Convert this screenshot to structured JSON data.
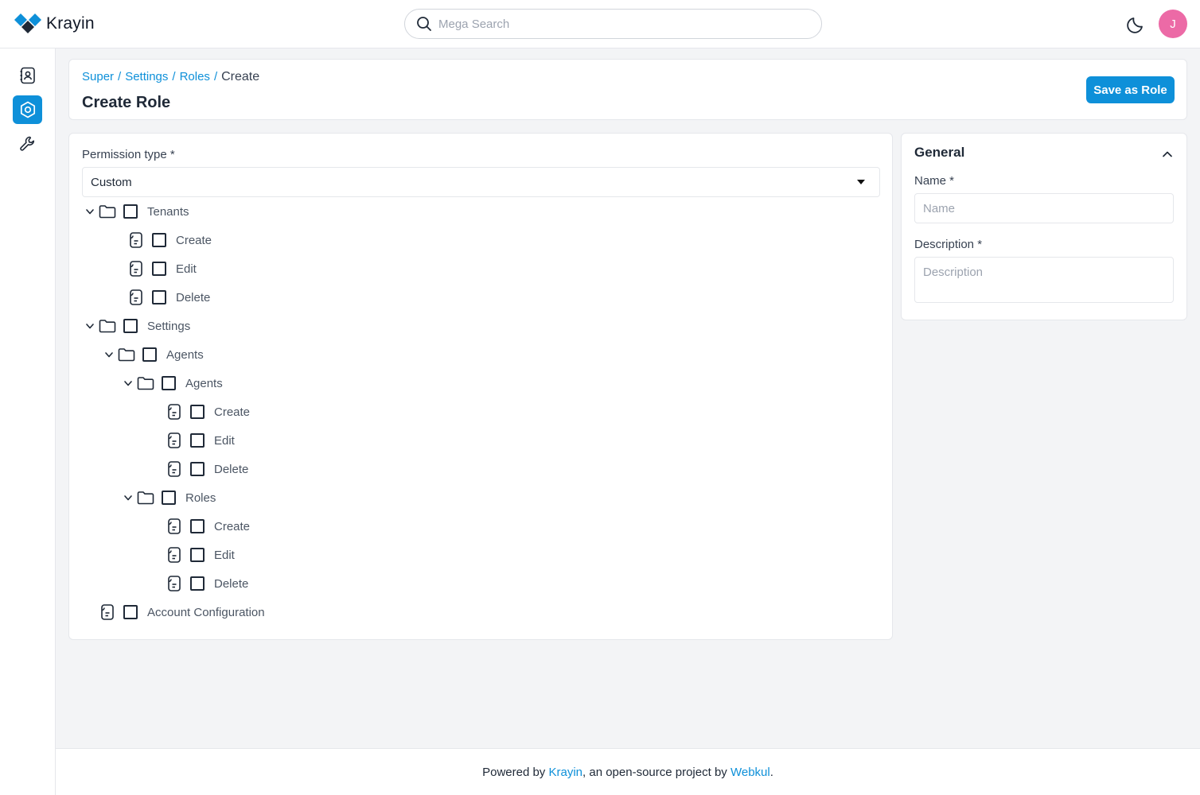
{
  "app": {
    "name": "Krayin"
  },
  "header": {
    "search_placeholder": "Mega Search",
    "avatar_initial": "J"
  },
  "sidebar": {
    "items": [
      {
        "name": "contacts-icon"
      },
      {
        "name": "settings-icon",
        "active": true
      },
      {
        "name": "wrench-icon"
      }
    ]
  },
  "breadcrumb": [
    "Super",
    "/",
    "Settings",
    "/",
    "Roles",
    "/",
    "Create"
  ],
  "page": {
    "title": "Create Role",
    "save_label": "Save as Role"
  },
  "permissions": {
    "label": "Permission type *",
    "selected": "Custom",
    "tree": [
      {
        "label": "Tenants",
        "type": "folder"
      },
      {
        "label": "Create",
        "type": "file"
      },
      {
        "label": "Edit",
        "type": "file"
      },
      {
        "label": "Delete",
        "type": "file"
      },
      {
        "label": "Settings",
        "type": "folder"
      },
      {
        "label": "Agents",
        "type": "folder"
      },
      {
        "label": "Agents",
        "type": "folder"
      },
      {
        "label": "Create",
        "type": "file"
      },
      {
        "label": "Edit",
        "type": "file"
      },
      {
        "label": "Delete",
        "type": "file"
      },
      {
        "label": "Roles",
        "type": "folder"
      },
      {
        "label": "Create",
        "type": "file"
      },
      {
        "label": "Edit",
        "type": "file"
      },
      {
        "label": "Delete",
        "type": "file"
      },
      {
        "label": "Account Configuration",
        "type": "file"
      }
    ]
  },
  "general": {
    "title": "General",
    "name_label": "Name *",
    "name_placeholder": "Name",
    "description_label": "Description *",
    "description_placeholder": "Description"
  },
  "footer": {
    "prefix": "Powered by",
    "krayin_link": "Krayin",
    "middle": ", an open-source project by",
    "webkul_link": "Webkul",
    "suffix": "."
  },
  "colors": {
    "accent": "#0e90d9",
    "avatar": "#ec6aa6"
  }
}
